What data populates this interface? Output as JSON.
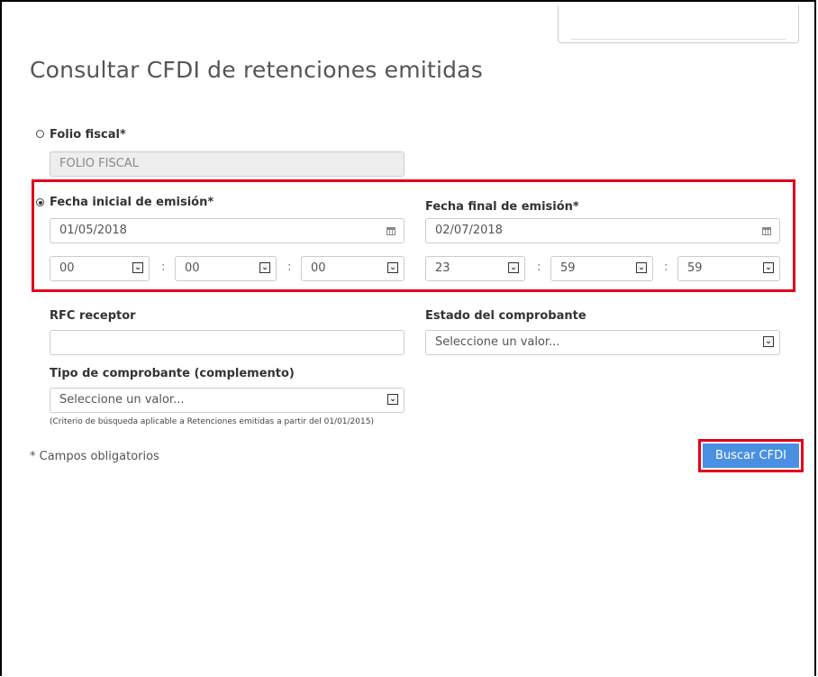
{
  "page": {
    "title": "Consultar CFDI de retenciones emitidas"
  },
  "folio": {
    "label": "Folio fiscal*",
    "placeholder": "FOLIO FISCAL",
    "selected": false
  },
  "fecha_inicial": {
    "label": "Fecha inicial de emisión*",
    "selected": true,
    "date": "01/05/2018",
    "hour": "00",
    "minute": "00",
    "second": "00"
  },
  "fecha_final": {
    "label": "Fecha final de emisión*",
    "date": "02/07/2018",
    "hour": "23",
    "minute": "59",
    "second": "59"
  },
  "rfc": {
    "label": "RFC receptor",
    "value": ""
  },
  "estado": {
    "label": "Estado del comprobante",
    "value": "Seleccione un valor..."
  },
  "tipo": {
    "label": "Tipo de comprobante (complemento)",
    "value": "Seleccione un valor...",
    "note": "(Criterio de búsqueda aplicable a Retenciones emitidas a partir del 01/01/2015)"
  },
  "footer": {
    "required_note": "* Campos obligatorios",
    "search_button": "Buscar CFDI"
  },
  "colors": {
    "highlight": "#e2001a",
    "button": "#4a90e2"
  }
}
